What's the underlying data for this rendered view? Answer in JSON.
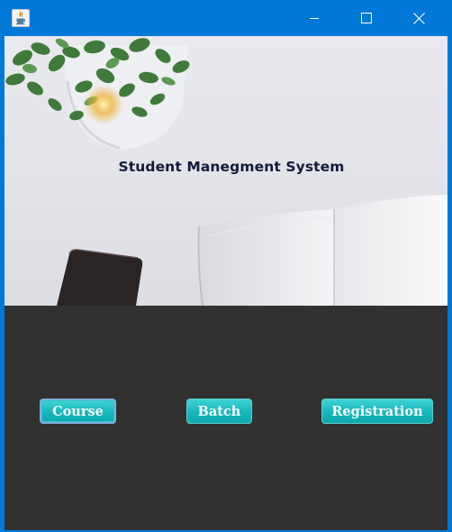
{
  "window": {
    "icon": "java-icon",
    "controls": [
      "minimize-icon",
      "maximize-icon",
      "close-icon"
    ]
  },
  "hero": {
    "title": "Student Manegment System"
  },
  "buttons": {
    "course": "Course",
    "batch": "Batch",
    "registration": "Registration"
  },
  "colors": {
    "titlebar": "#0078d7",
    "panel": "#313131",
    "button": "#16b7bd",
    "title_text": "#141a3b"
  }
}
